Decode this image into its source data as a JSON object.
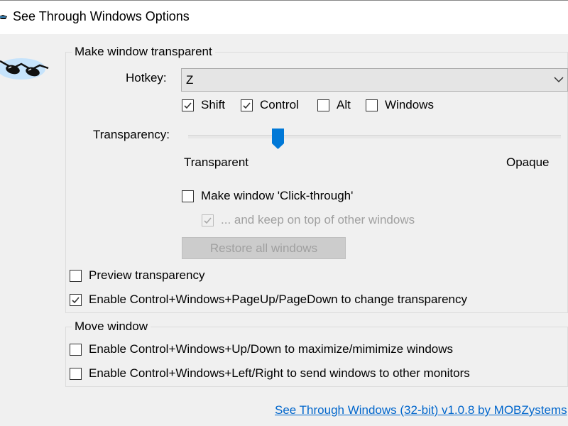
{
  "window": {
    "title": "See Through Windows Options"
  },
  "transparent_group": {
    "legend": "Make window transparent",
    "hotkey_label": "Hotkey:",
    "hotkey_value": "Z",
    "modifiers": [
      {
        "label": "Shift",
        "checked": true
      },
      {
        "label": "Control",
        "checked": true
      },
      {
        "label": "Alt",
        "checked": false
      },
      {
        "label": "Windows",
        "checked": false
      }
    ],
    "transparency_label": "Transparency:",
    "transparency_level_fraction": 0.24,
    "slider_min_label": "Transparent",
    "slider_max_label": "Opaque",
    "click_through": {
      "label": "Make window 'Click-through'",
      "checked": false
    },
    "keep_on_top": {
      "label": "... and keep on top of other windows",
      "checked": true,
      "disabled": true
    },
    "restore_button_label": "Restore all windows",
    "preview": {
      "label": "Preview transparency",
      "checked": false
    },
    "enable_pageup": {
      "label": "Enable Control+Windows+PageUp/PageDown to change transparency",
      "checked": true
    }
  },
  "move_group": {
    "legend": "Move window",
    "maximize": {
      "label": "Enable Control+Windows+Up/Down to maximize/mimimize windows",
      "checked": false
    },
    "monitors": {
      "label": "Enable Control+Windows+Left/Right to send windows to other monitors",
      "checked": false
    }
  },
  "footer": {
    "link_text": "See Through Windows (32-bit) v1.0.8 by MOBZystems"
  },
  "icons": {
    "title": "sunglasses-icon",
    "logo": "sunglasses-logo",
    "dropdown": "chevron-down-icon",
    "check": "checkmark-icon"
  },
  "colors": {
    "slider_thumb": "#0078d7",
    "link": "#0066cc",
    "window_bg": "#f0f0f0"
  }
}
